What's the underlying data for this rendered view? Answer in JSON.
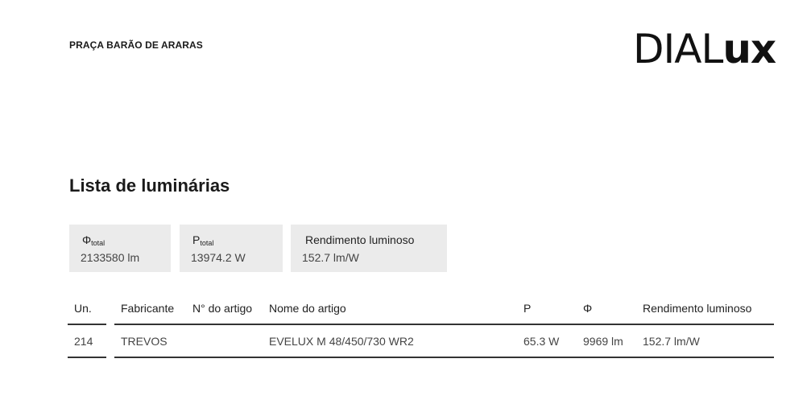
{
  "header": {
    "project_name": "PRAÇA BARÃO DE ARARAS",
    "logo": {
      "part1": "DIAL",
      "part2": "ux"
    }
  },
  "page_title": "Lista de luminárias",
  "summary": {
    "flux": {
      "symbol": "Φ",
      "sub": "total",
      "value": "2133580 lm"
    },
    "power": {
      "symbol": "P",
      "sub": "total",
      "value": "13974.2 W"
    },
    "efficacy": {
      "label": "Rendimento luminoso",
      "value": "152.7 lm/W"
    }
  },
  "table": {
    "headers": [
      "Un.",
      "Fabricante",
      "N° do artigo",
      "Nome do artigo",
      "P",
      "Φ",
      "Rendimento luminoso"
    ],
    "rows": [
      [
        "214",
        "TREVOS",
        "",
        "EVELUX M 48/450/730 WR2",
        "65.3 W",
        "9969 lm",
        "152.7 lm/W"
      ]
    ]
  }
}
